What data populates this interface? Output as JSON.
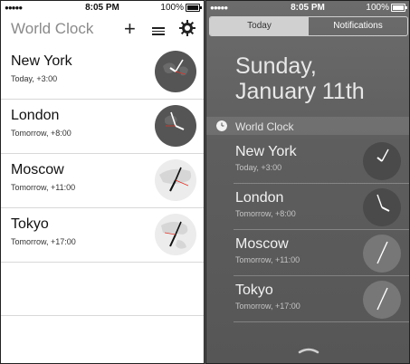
{
  "left": {
    "status": {
      "signal": "●●●●●",
      "time": "8:05 PM",
      "battery": "100%"
    },
    "title": "World Clock",
    "plus_glyph": "+",
    "icons": {
      "add": "plus-icon",
      "list": "list-icon",
      "settings": "gear-icon"
    },
    "rows": [
      {
        "city": "New York",
        "sub": "Today, +3:00",
        "theme": "dark"
      },
      {
        "city": "London",
        "sub": "Tomorrow, +8:00",
        "theme": "dark"
      },
      {
        "city": "Moscow",
        "sub": "Tomorrow, +11:00",
        "theme": "light"
      },
      {
        "city": "Tokyo",
        "sub": "Tomorrow, +17:00",
        "theme": "light"
      }
    ]
  },
  "right": {
    "status": {
      "signal": "●●●●●",
      "time": "8:05 PM",
      "battery": "100%"
    },
    "tabs": [
      {
        "label": "Today",
        "active": true
      },
      {
        "label": "Notifications",
        "active": false
      }
    ],
    "date_line1": "Sunday,",
    "date_line2": "January 11th",
    "widget_title": "World Clock",
    "rows": [
      {
        "city": "New York",
        "sub": "Today, +3:00",
        "theme": "dark"
      },
      {
        "city": "London",
        "sub": "Tomorrow, +8:00",
        "theme": "dark"
      },
      {
        "city": "Moscow",
        "sub": "Tomorrow, +11:00",
        "theme": "light"
      },
      {
        "city": "Tokyo",
        "sub": "Tomorrow, +17:00",
        "theme": "light"
      }
    ]
  },
  "colors": {
    "accent_red": "#d9342b",
    "light_bg": "#ffffff",
    "widget_bg": "#5e5e5e"
  }
}
